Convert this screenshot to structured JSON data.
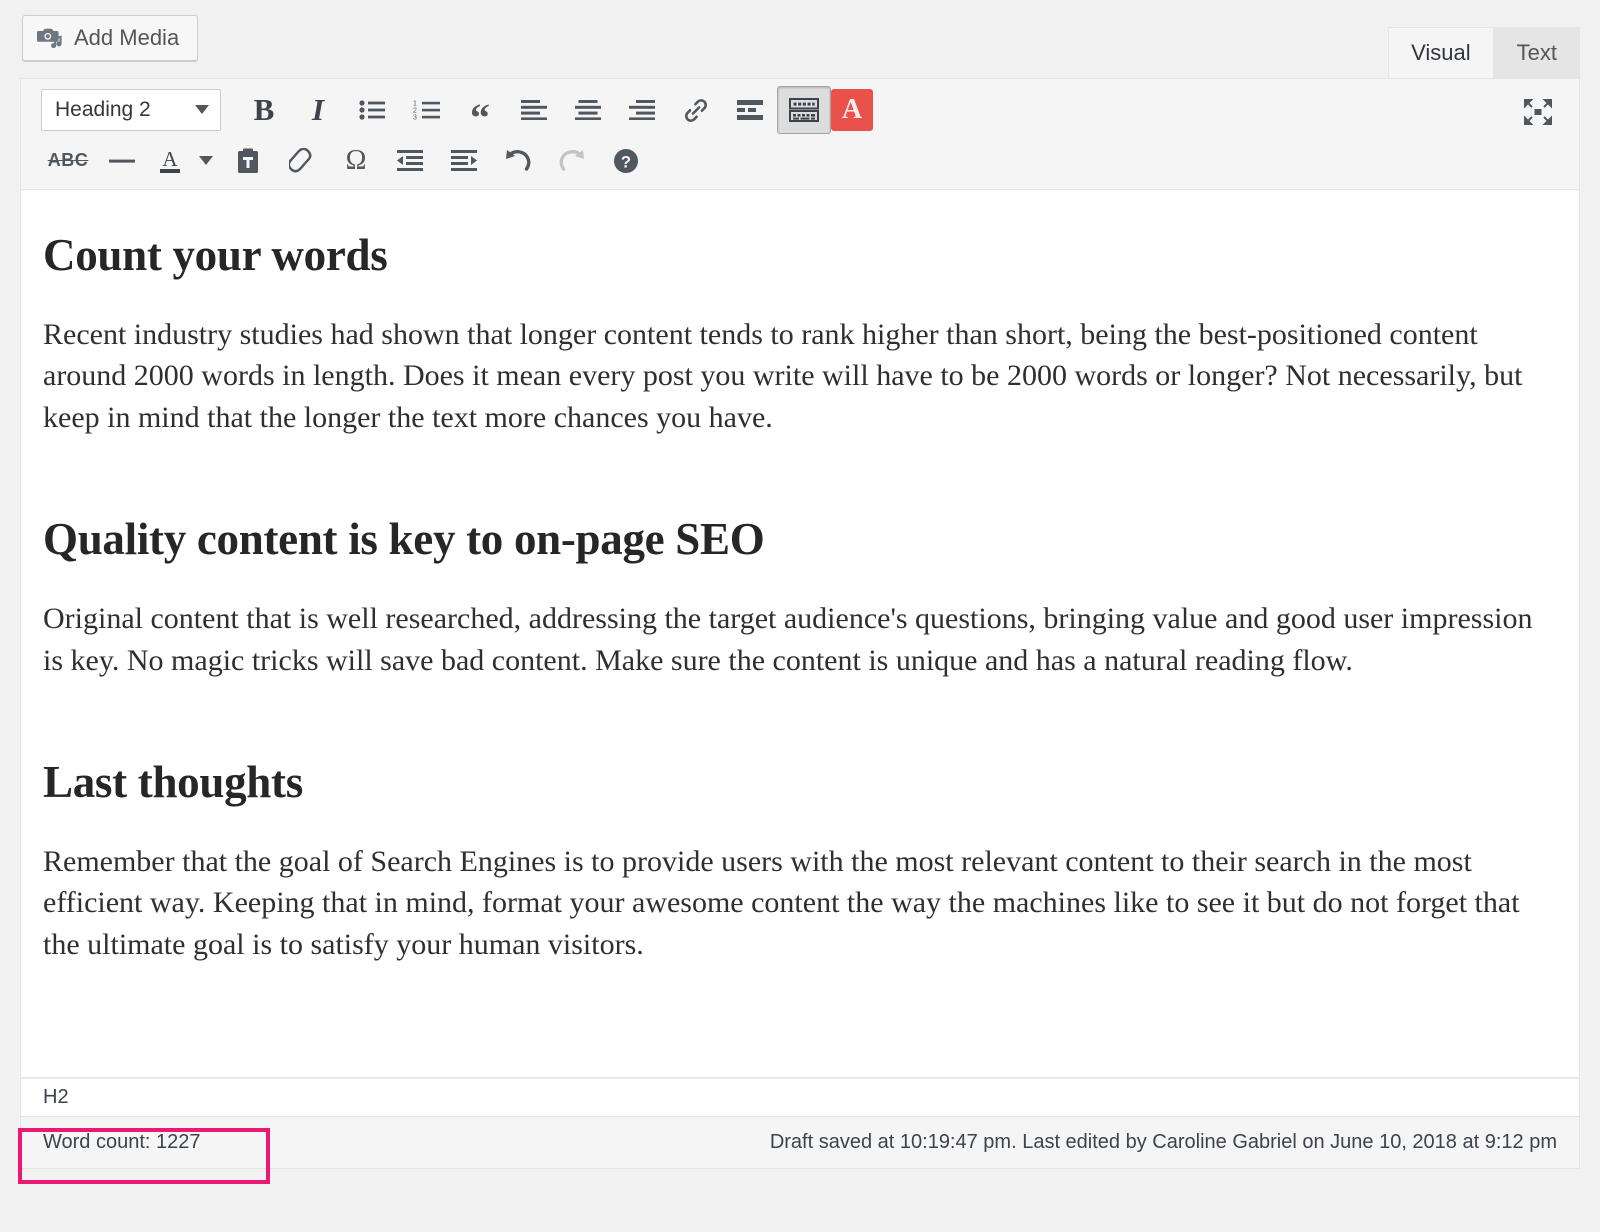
{
  "toolbar_top": {
    "add_media_label": "Add Media",
    "tabs": [
      {
        "label": "Visual",
        "active": true
      },
      {
        "label": "Text",
        "active": false
      }
    ]
  },
  "format_toolbar": {
    "style_select_value": "Heading 2",
    "row1": [
      {
        "name": "bold-button",
        "label": "B"
      },
      {
        "name": "italic-button",
        "label": "I"
      },
      {
        "name": "bulleted-list-button",
        "label": "Bulleted list"
      },
      {
        "name": "numbered-list-button",
        "label": "Numbered list"
      },
      {
        "name": "blockquote-button",
        "label": "Blockquote"
      },
      {
        "name": "align-left-button",
        "label": "Align left"
      },
      {
        "name": "align-center-button",
        "label": "Align center"
      },
      {
        "name": "align-right-button",
        "label": "Align right"
      },
      {
        "name": "insert-link-button",
        "label": "Insert/edit link"
      },
      {
        "name": "read-more-button",
        "label": "Insert Read More tag"
      },
      {
        "name": "toolbar-toggle-button",
        "label": "Toolbar Toggle",
        "pressed": true
      },
      {
        "name": "red-a-button",
        "label": "A"
      }
    ],
    "row2": [
      {
        "name": "strikethrough-button",
        "label": "ABC"
      },
      {
        "name": "horizontal-line-button",
        "label": "Horizontal line"
      },
      {
        "name": "text-color-button",
        "label": "A"
      },
      {
        "name": "text-color-dropdown",
        "label": "Text color options"
      },
      {
        "name": "paste-as-text-button",
        "label": "Paste as text"
      },
      {
        "name": "clear-formatting-button",
        "label": "Clear formatting"
      },
      {
        "name": "special-character-button",
        "label": "Ω"
      },
      {
        "name": "decrease-indent-button",
        "label": "Decrease indent"
      },
      {
        "name": "increase-indent-button",
        "label": "Increase indent"
      },
      {
        "name": "undo-button",
        "label": "Undo"
      },
      {
        "name": "redo-button",
        "label": "Redo",
        "disabled": true
      },
      {
        "name": "keyboard-shortcuts-button",
        "label": "Keyboard Shortcuts"
      }
    ],
    "fullscreen_label": "Distraction-free writing mode"
  },
  "content": {
    "blocks": [
      {
        "heading": "Count your words",
        "paragraph": "Recent industry studies had shown that longer content tends to rank higher than short, being the best-positioned content around 2000 words in length. Does it mean every post you write will have to be 2000 words or longer? Not necessarily, but keep in mind that the longer the text more chances you have."
      },
      {
        "heading": "Quality content is key to on-page SEO",
        "paragraph": "Original content that is well researched, addressing the target audience's questions, bringing value and good user impression is key. No magic tricks will save bad content. Make sure the content is unique and has a natural reading flow."
      },
      {
        "heading": "Last thoughts",
        "paragraph": "Remember that the goal of Search Engines is to provide users with the most relevant content to their search in the most efficient way. Keeping that in mind, format your awesome content the way the machines like to see it but do not forget that the ultimate goal is to satisfy your human visitors."
      }
    ]
  },
  "status": {
    "element_path": "H2",
    "word_count": "Word count: 1227",
    "autosave_notice": "Draft saved at 10:19:47 pm. Last edited by Caroline Gabriel on June 10, 2018 at 9:12 pm"
  },
  "annotation": {
    "highlight_color": "#ea1a72",
    "highlight_target": "word-count-status"
  }
}
